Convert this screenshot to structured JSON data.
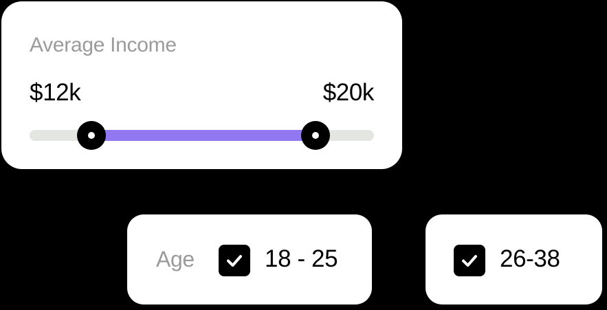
{
  "income_filter": {
    "title": "Average Income",
    "min_label": "$12k",
    "max_label": "$20k",
    "range": {
      "lower_fraction": 0.18,
      "upper_fraction": 0.83
    },
    "colors": {
      "track": "#e4e6e1",
      "fill": "#9278f0",
      "thumb": "#000000"
    }
  },
  "age_filter": {
    "label": "Age",
    "options": [
      {
        "label": "18 - 25",
        "checked": true,
        "icon": "check-icon"
      },
      {
        "label": "26-38",
        "checked": true,
        "icon": "check-icon"
      }
    ]
  }
}
